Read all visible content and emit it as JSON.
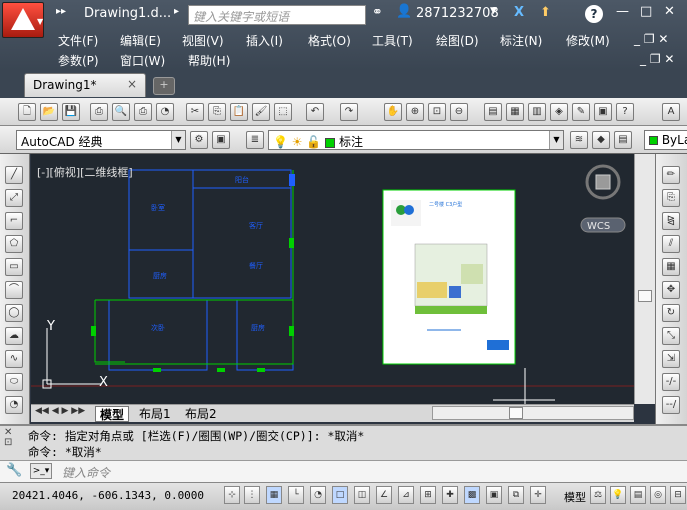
{
  "title_bar": {
    "doc_title": "Drawing1.d...",
    "search_placeholder": "键入关键字或短语",
    "user_id": "2871232708",
    "help_label": "?"
  },
  "menu": {
    "row1": [
      "文件(F)",
      "编辑(E)",
      "视图(V)",
      "插入(I)",
      "格式(O)",
      "工具(T)",
      "绘图(D)",
      "标注(N)",
      "修改(M)"
    ],
    "row2": [
      "参数(P)",
      "窗口(W)",
      "帮助(H)"
    ]
  },
  "tabs": {
    "active": "Drawing1*",
    "close": "×"
  },
  "toolbar2": {
    "workspace": "AutoCAD 经典",
    "layer": "标注",
    "color": "ByLa"
  },
  "viewport": {
    "label": "[-][俯视][二维线框]",
    "wcs": "WCS",
    "y_axis": "Y",
    "x_axis": "X",
    "rooms": [
      "阳台",
      "卧室",
      "客厅",
      "厨房",
      "餐厅",
      "次卧",
      "厨房"
    ],
    "image_title": "二号楼 C3户型"
  },
  "layout_tabs": [
    "模型",
    "布局1",
    "布局2"
  ],
  "command": {
    "line1": "命令: 指定对角点或 [栏选(F)/圈围(WP)/圈交(CP)]: *取消*",
    "line2": "命令: *取消*",
    "placeholder": "键入命令"
  },
  "status": {
    "coords": "20421.4046, -606.1343, 0.0000",
    "model": "模型"
  },
  "colors": {
    "accent_green": "#00d000",
    "line_blue": "#1f5fff",
    "grid_red": "#7a2020"
  }
}
